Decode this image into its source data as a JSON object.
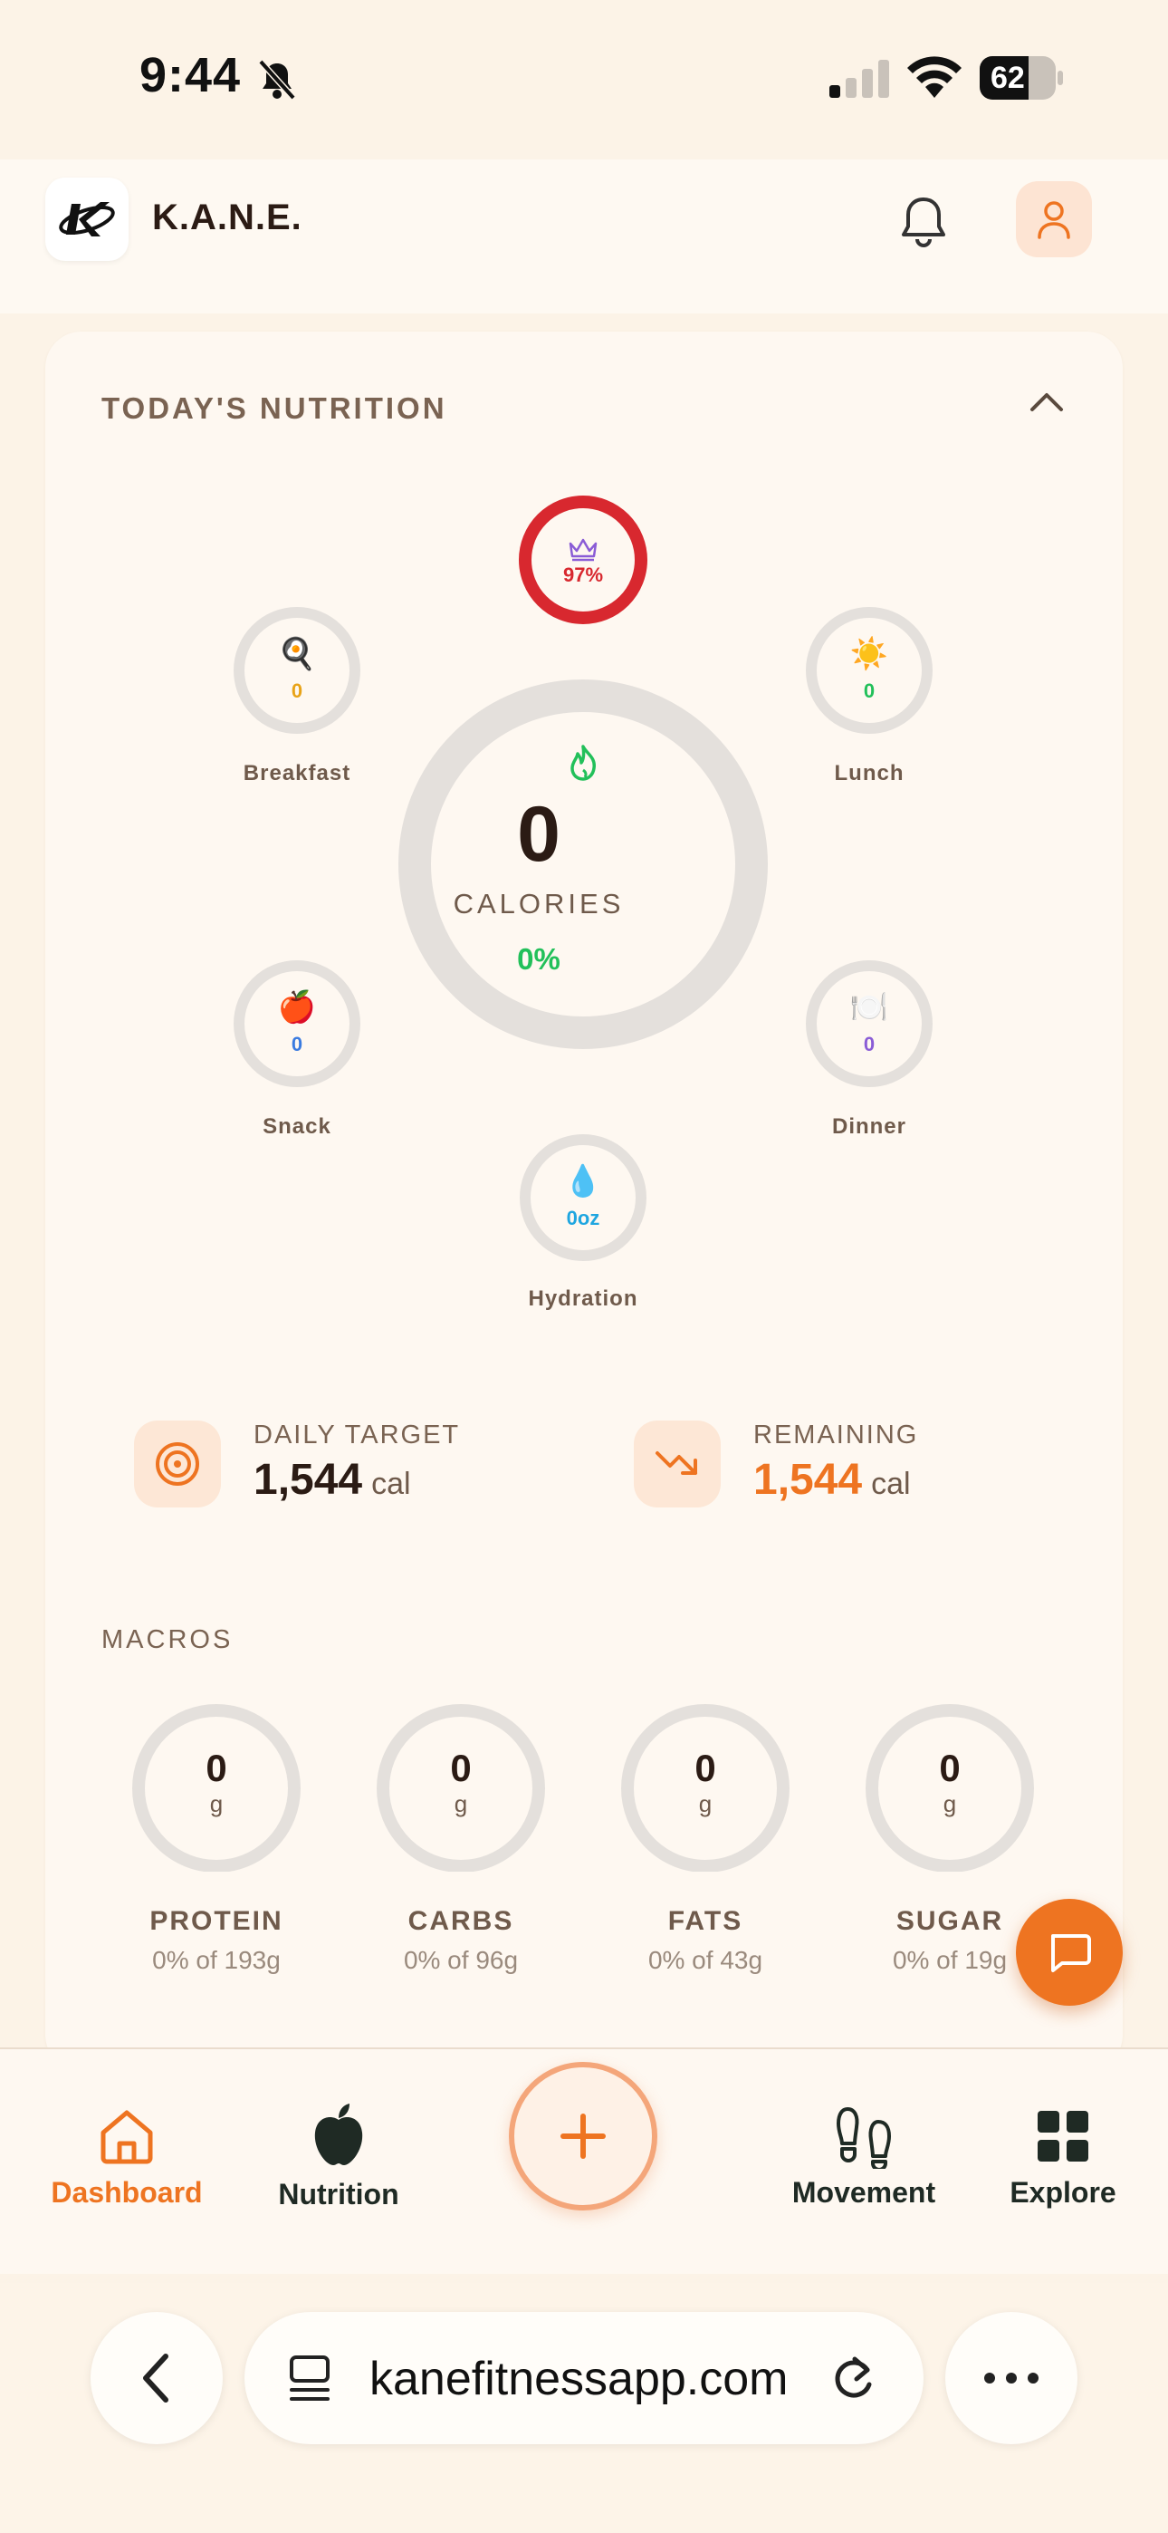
{
  "status": {
    "time": "9:44",
    "battery": "62"
  },
  "header": {
    "app_name": "K.A.N.E."
  },
  "nutrition": {
    "title": "TODAY'S NUTRITION",
    "goal_percent": "97%",
    "calories": {
      "value": "0",
      "label": "CALORIES",
      "percent": "0%"
    },
    "meals": [
      {
        "name": "Breakfast",
        "value": "0",
        "emoji": "🍳",
        "color": "#e8a317"
      },
      {
        "name": "Lunch",
        "value": "0",
        "emoji": "☀️",
        "color": "#22c05a"
      },
      {
        "name": "Snack",
        "value": "0",
        "emoji": "🍎",
        "color": "#3a7be0"
      },
      {
        "name": "Dinner",
        "value": "0",
        "emoji": "🍽️",
        "color": "#8a5cd6"
      },
      {
        "name": "Hydration",
        "value": "0oz",
        "emoji": "💧",
        "color": "#1fa6e0"
      }
    ],
    "daily_target": {
      "label": "DAILY TARGET",
      "value": "1,544",
      "unit": "cal"
    },
    "remaining": {
      "label": "REMAINING",
      "value": "1,544",
      "unit": "cal"
    },
    "macros_title": "MACROS",
    "macros": [
      {
        "name": "PROTEIN",
        "value": "0",
        "unit": "g",
        "sub": "0% of 193g"
      },
      {
        "name": "CARBS",
        "value": "0",
        "unit": "g",
        "sub": "0% of 96g"
      },
      {
        "name": "FATS",
        "value": "0",
        "unit": "g",
        "sub": "0% of 43g"
      },
      {
        "name": "SUGAR",
        "value": "0",
        "unit": "g",
        "sub": "0% of 19g"
      }
    ]
  },
  "nav": {
    "dashboard": "Dashboard",
    "nutrition": "Nutrition",
    "movement": "Movement",
    "explore": "Explore"
  },
  "browser": {
    "url": "kanefitnessapp.com"
  },
  "colors": {
    "accent": "#ee7421",
    "ring_red": "#d8282f",
    "ring_track": "#e4e0dc",
    "crown": "#8a5cd6"
  }
}
